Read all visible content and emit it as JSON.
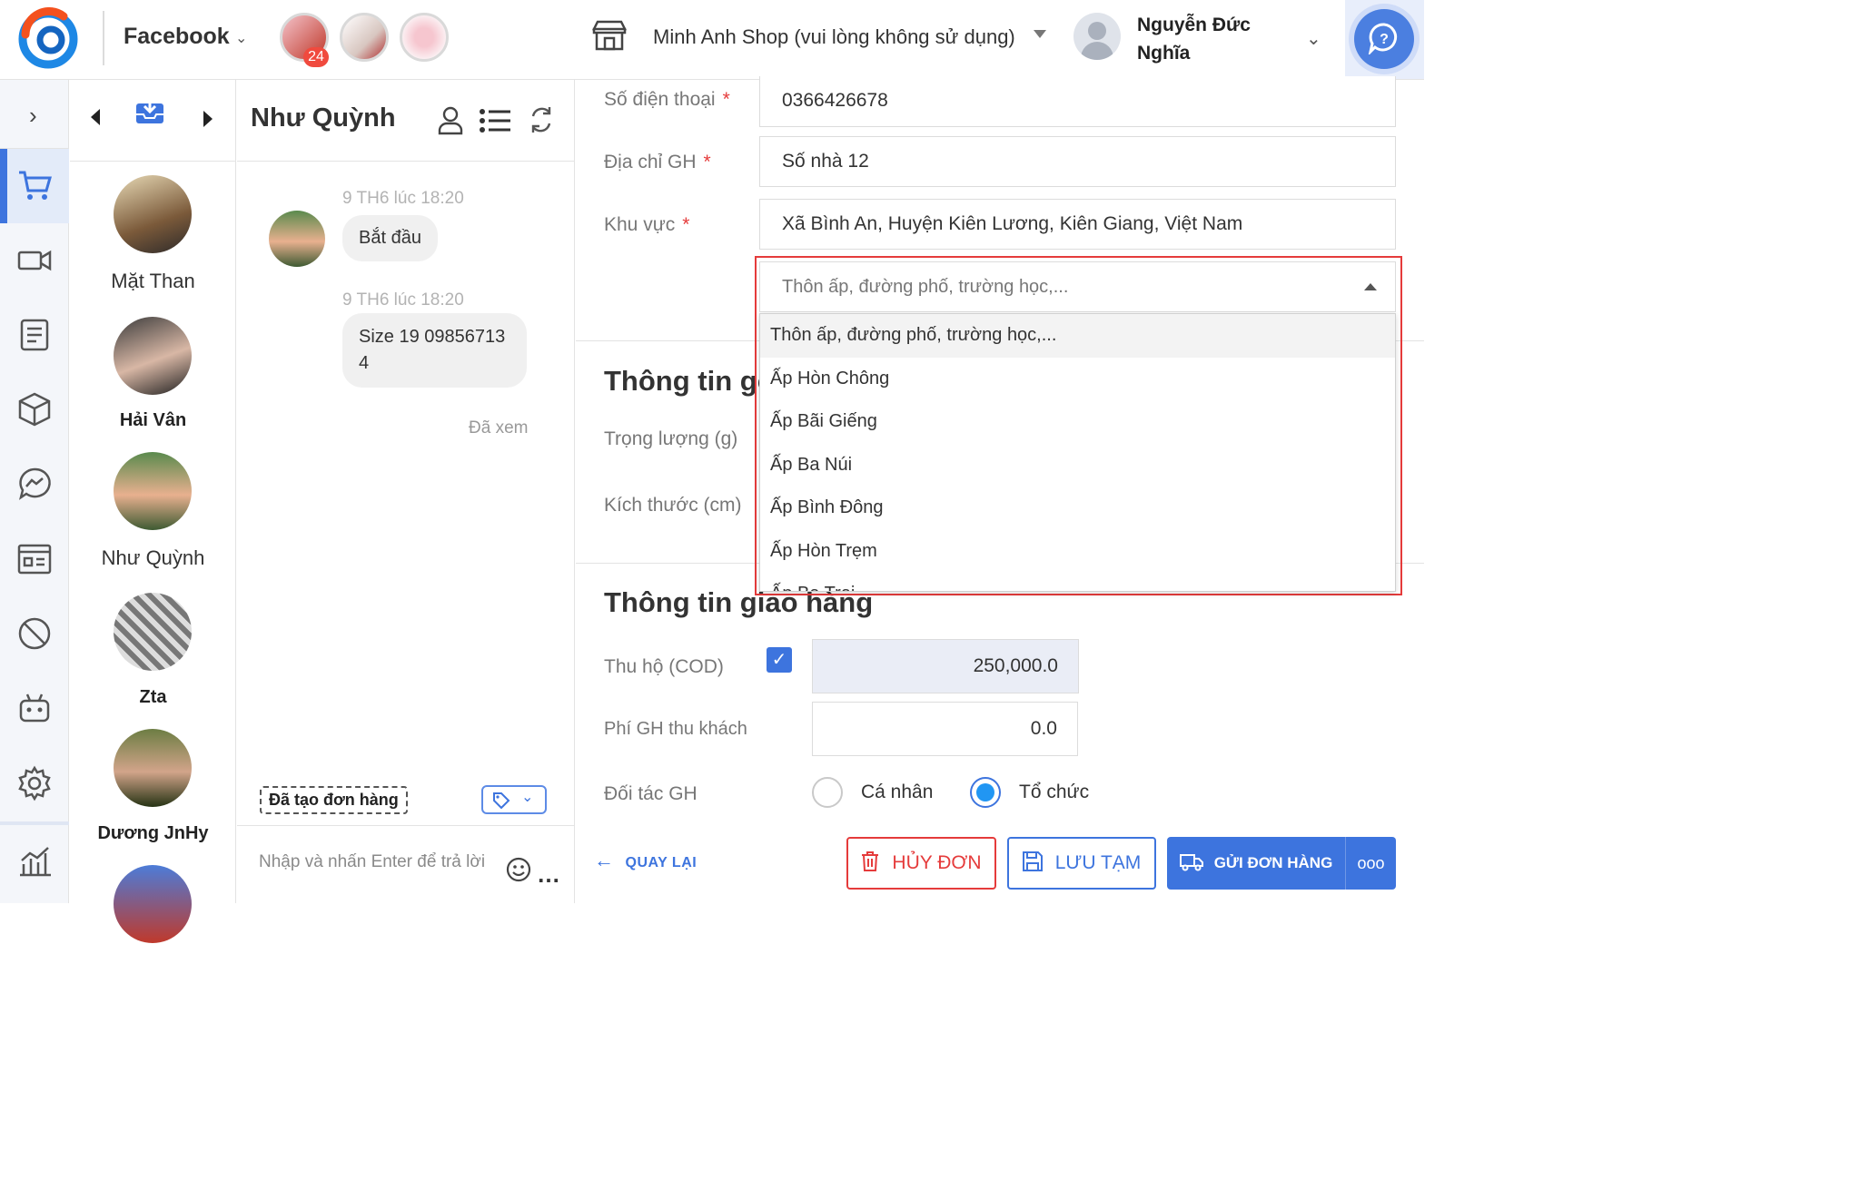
{
  "header": {
    "channel": "Facebook",
    "page_badge_count": "24",
    "shop_name": "Minh Anh Shop (vui lòng không sử dụng)",
    "user_name": "Nguyễn Đức Nghĩa"
  },
  "contacts": [
    {
      "name": "Mặt Than"
    },
    {
      "name": "Hải Vân"
    },
    {
      "name": "Như Quỳnh"
    },
    {
      "name": "Zta"
    },
    {
      "name": "Dương JnHy"
    }
  ],
  "chat": {
    "title": "Như Quỳnh",
    "messages": [
      {
        "time": "9 TH6 lúc 18:20",
        "text": "Bắt đầu"
      },
      {
        "time": "9 TH6 lúc 18:20",
        "text": "Size 19 09856713 4"
      }
    ],
    "seen": "Đã xem",
    "created_label": "Đã tạo đơn hàng",
    "input_placeholder": "Nhập và nhấn Enter để trả lời"
  },
  "form": {
    "phone_label": "Số điện thoại",
    "phone_value": "0366426678",
    "address_label": "Địa chỉ GH",
    "address_value": "Số nhà 12",
    "area_label": "Khu vực",
    "area_value": "Xã Bình An, Huyện Kiên Lương, Kiên Giang, Việt Nam",
    "hamlet_placeholder": "Thôn ấp, đường phố, trường học,...",
    "package_section": "Thông tin gói",
    "weight_label": "Trọng lượng (g)",
    "size_label": "Kích thước (cm)",
    "delivery_section": "Thông tin giao hàng",
    "cod_label": "Thu hộ (COD)",
    "cod_value": "250,000.0",
    "fee_label": "Phí GH thu khách",
    "fee_value": "0.0",
    "partner_label": "Đối tác GH",
    "partner_personal": "Cá nhân",
    "partner_org": "Tổ chức"
  },
  "dropdown": {
    "items": [
      "Thôn ấp, đường phố, trường học,...",
      "Ấp Hòn Chông",
      "Ấp Bãi Giếng",
      "Ấp Ba Núi",
      "Ấp Bình Đông",
      "Ấp Hòn Trẹm",
      "Ấp Ba Trại"
    ]
  },
  "actions": {
    "back": "QUAY LẠI",
    "cancel": "HỦY ĐƠN",
    "save": "LƯU TẠM",
    "send": "GỬI ĐƠN HÀNG",
    "more": "ooo"
  }
}
